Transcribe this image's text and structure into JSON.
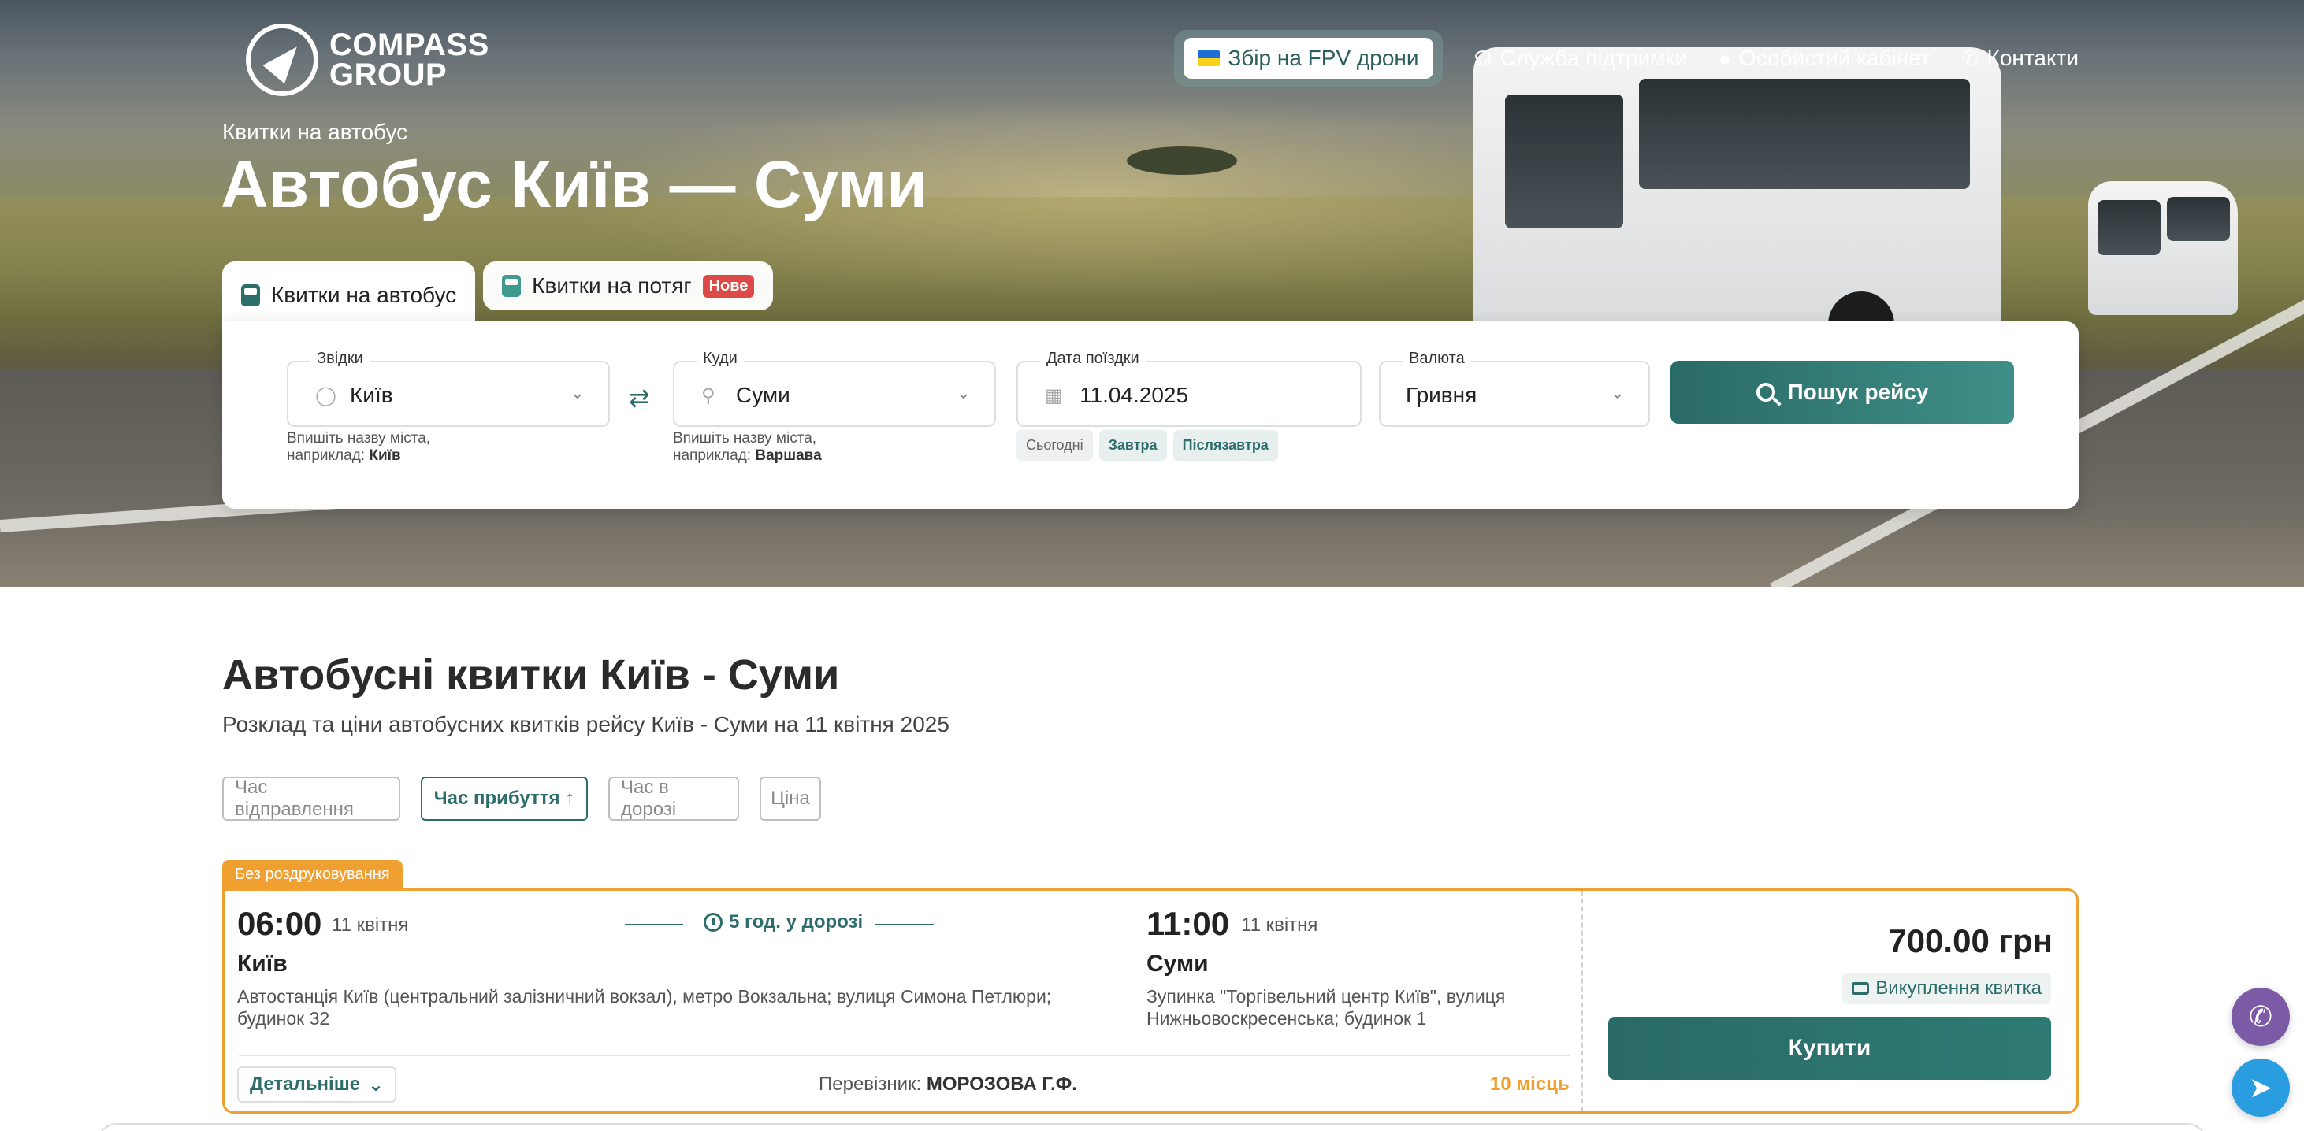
{
  "brand": {
    "line1": "COMPASS",
    "line2": "GROUP"
  },
  "nav": {
    "fpv": "Збір на FPV дрони",
    "support": "Служба підтримки",
    "cabinet": "Особистий кабінет",
    "contacts": "Контакти"
  },
  "hero": {
    "subtitle": "Квитки на автобус",
    "title": "Автобус Київ — Суми"
  },
  "tabs": [
    {
      "label": "Квитки на автобус",
      "active": true
    },
    {
      "label": "Квитки на потяг",
      "badge": "Нове",
      "active": false
    }
  ],
  "search": {
    "from": {
      "label": "Звідки",
      "value": "Київ",
      "hint_line1": "Впишіть назву міста,",
      "hint_prefix": "наприклад:",
      "hint_example": "Київ"
    },
    "to": {
      "label": "Куди",
      "value": "Суми",
      "hint_line1": "Впишіть назву міста,",
      "hint_prefix": "наприклад:",
      "hint_example": "Варшава"
    },
    "date": {
      "label": "Дата поїздки",
      "value": "11.04.2025",
      "quick": [
        "Сьогодні",
        "Завтра",
        "Післязавтра"
      ]
    },
    "currency": {
      "label": "Валюта",
      "value": "Гривня"
    },
    "button": "Пошук рейсу"
  },
  "results": {
    "title": "Автобусні квитки Київ - Суми",
    "description": "Розклад та ціни автобусних квитків рейсу Київ - Суми на 11 квітня 2025",
    "sort": [
      "Час відправлення",
      "Час прибуття  ↑",
      "Час в дорозі",
      "Ціна"
    ]
  },
  "trip": {
    "ribbon": "Без роздруковування",
    "depart_time": "06:00",
    "depart_date": "11 квітня",
    "depart_city": "Київ",
    "depart_addr": "Автостанція Київ (центральний залізничний вокзал), метро Вокзальна; вулиця Симона Петлюри; будинок 32",
    "duration": "5 год. у дорозі",
    "arrive_time": "11:00",
    "arrive_date": "11 квітня",
    "arrive_city": "Суми",
    "arrive_addr": "Зупинка \"Торгівельний центр Київ\", вулиця Нижньовоскресенська; будинок 1",
    "details": "Детальніше",
    "carrier_label": "Перевізник:",
    "carrier": "МОРОЗОВА Г.Ф.",
    "seats": "10 місць",
    "price": "700.00 грн",
    "refund": "Викуплення квитка",
    "buy": "Купити"
  },
  "colors": {
    "accent": "#2d6e6a",
    "warning": "#f0a030",
    "badge": "#e04848"
  }
}
